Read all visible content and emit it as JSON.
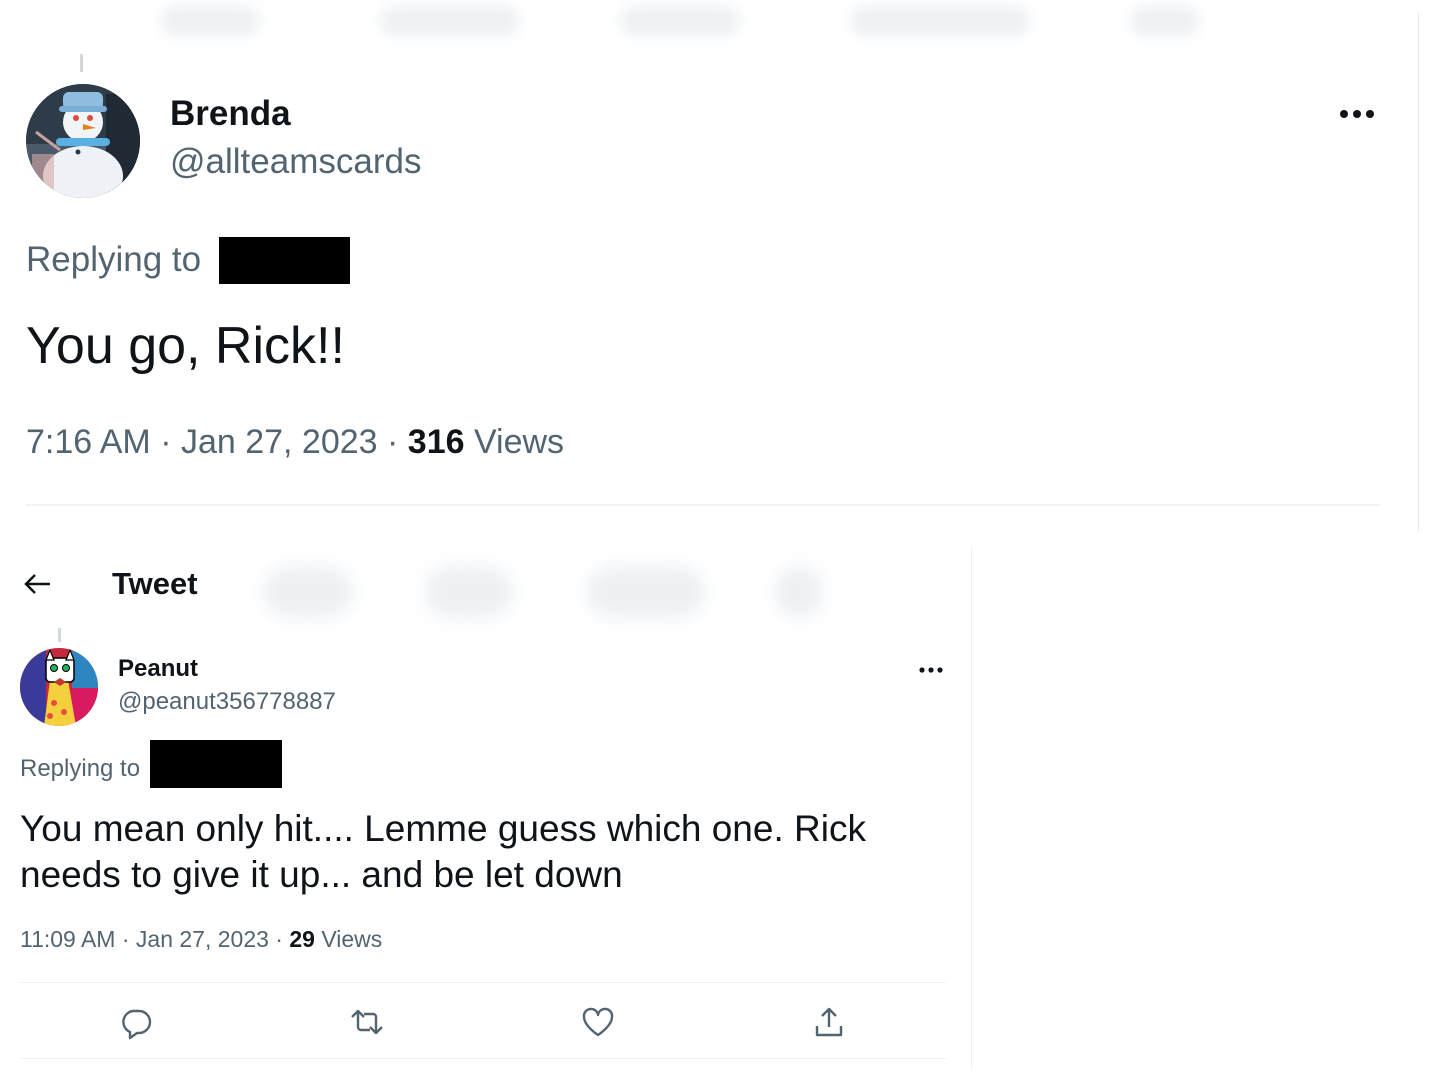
{
  "tweet_top": {
    "name": "Brenda",
    "handle": "@allteamscards",
    "replying_label": "Replying to",
    "text": "You go, Rick!!",
    "timestamp": "7:16 AM · Jan 27, 2023 · ",
    "views_count": "316",
    "views_label": " Views"
  },
  "tweet_bottom": {
    "header_title": "Tweet",
    "name": "Peanut",
    "handle": "@peanut356778887",
    "replying_label": "Replying to",
    "text": "You mean only hit.... Lemme guess which one. Rick needs to give it up... and be let down",
    "timestamp": "11:09 AM · Jan 27, 2023 · ",
    "views_count": "29",
    "views_label": " Views"
  },
  "actions": {
    "reply_icon": "reply-icon",
    "retweet_icon": "retweet-icon",
    "like_icon": "like-icon",
    "share_icon": "share-icon",
    "icon_color": "#536471"
  },
  "colors": {
    "text_primary": "#0f1419",
    "text_secondary": "#536471",
    "divider": "#eff3f4"
  }
}
